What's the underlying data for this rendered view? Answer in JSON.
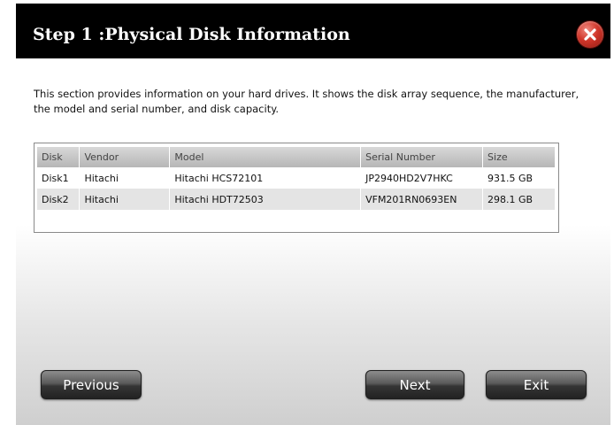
{
  "dialog": {
    "title": "Step 1 :Physical Disk Information",
    "close_icon": "close-x-icon",
    "description": "This section provides information on your hard drives. It shows the disk array sequence, the manufacturer, the model and serial number, and disk capacity."
  },
  "table": {
    "columns": [
      "Disk",
      "Vendor",
      "Model",
      "Serial Number",
      "Size"
    ],
    "rows": [
      [
        "Disk1",
        "Hitachi",
        "Hitachi HCS72101",
        "JP2940HD2V7HKC",
        "931.5 GB"
      ],
      [
        "Disk2",
        "Hitachi",
        "Hitachi HDT72503",
        "VFM201RN0693EN",
        "298.1 GB"
      ]
    ]
  },
  "buttons": {
    "previous": "Previous",
    "next": "Next",
    "exit": "Exit"
  },
  "colors": {
    "titlebar": "#000000",
    "close_button": "#d0362a",
    "header_row": "#c4c4c4",
    "alt_row": "#e4e4e4",
    "button": "#4a4a4a"
  }
}
